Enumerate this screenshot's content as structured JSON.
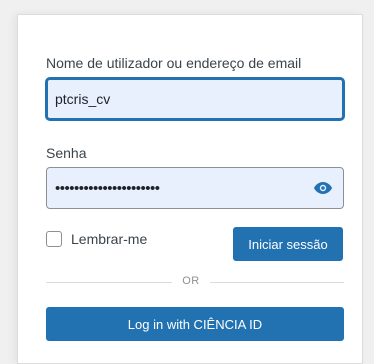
{
  "login": {
    "username_label": "Nome de utilizador ou endereço de email",
    "username_value": "ptcris_cv",
    "password_label": "Senha",
    "password_masked": "••••••••••••••••••••••",
    "show_password_icon": "eye-icon",
    "remember_label": "Lembrar-me",
    "remember_checked": false,
    "submit_label": "Iniciar sessão",
    "divider_text": "OR",
    "ciencia_button_label": "Log in with CIÊNCIA ID"
  },
  "colors": {
    "accent": "#2271b1",
    "autofill_bg": "#e8f0fe",
    "border": "#8c8f94"
  }
}
